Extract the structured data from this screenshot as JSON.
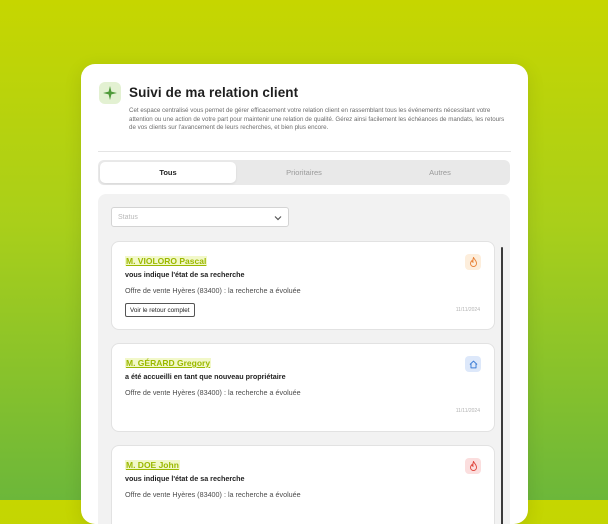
{
  "header": {
    "icon": "sparkle-icon",
    "title": "Suivi de ma relation client",
    "description": "Cet espace centralisé vous permet de gérer efficacement votre relation client en rassemblant tous les événements nécessitant votre attention ou une action de votre part pour maintenir une relation de qualité. Gérez ainsi facilement les échéances de mandats, les retours de vos clients sur l'avancement de leurs recherches, et bien plus encore."
  },
  "tabs": [
    {
      "label": "Tous",
      "active": true
    },
    {
      "label": "Prioritaires",
      "active": false
    },
    {
      "label": "Autres",
      "active": false
    }
  ],
  "filter": {
    "status_placeholder": "Status"
  },
  "cards": [
    {
      "name": "M. VIOLORO Pascal",
      "subtitle": "vous indique l'état de sa recherche",
      "detail": "Offre de vente Hyères (83400)  : la recherche a évoluée",
      "button": "Voir le retour complet",
      "date": "11/11/2024",
      "icon": "flame-icon",
      "icon_color": "#e8833a",
      "icon_bg": "#fdeedc"
    },
    {
      "name": "M. GÉRARD Gregory",
      "subtitle": "a été accueilli en tant que nouveau propriétaire",
      "detail": "Offre de vente Hyères (83400)  : la recherche a évoluée",
      "button": "",
      "date": "11/11/2024",
      "icon": "home-icon",
      "icon_color": "#3f7fd6",
      "icon_bg": "#dde8fa"
    },
    {
      "name": "M. DOE John",
      "subtitle": "vous indique l'état de sa recherche",
      "detail": "Offre de vente Hyères (83400)  : la recherche a évoluée",
      "button": "",
      "date": "",
      "icon": "flame-icon",
      "icon_color": "#e0473e",
      "icon_bg": "#fbdede"
    }
  ],
  "colors": {
    "accent": "#9bb800",
    "accent_bg": "#f2f8c9"
  }
}
